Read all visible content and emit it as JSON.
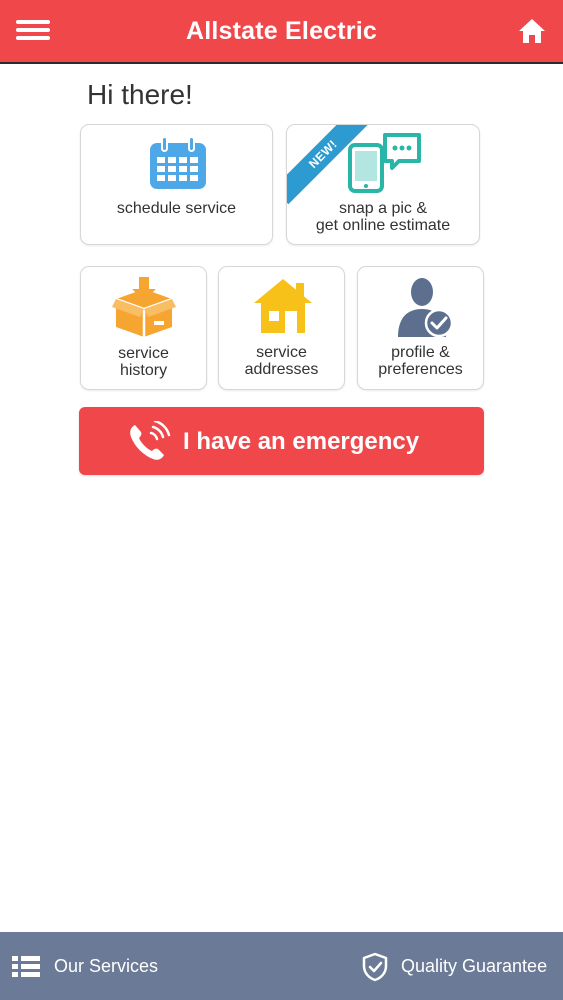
{
  "header": {
    "title": "Allstate Electric",
    "menu_icon": "hamburger-menu-icon",
    "home_icon": "home-icon"
  },
  "greeting": "Hi there!",
  "tiles": {
    "schedule": {
      "label": "schedule service",
      "icon": "calendar-icon"
    },
    "snap": {
      "badge": "NEW!",
      "label_line1": "snap a pic &",
      "label_line2": "get online estimate",
      "icon": "phone-chat-icon"
    },
    "history": {
      "label_line1": "service",
      "label_line2": "history",
      "icon": "box-download-icon"
    },
    "addresses": {
      "label_line1": "service",
      "label_line2": "addresses",
      "icon": "house-icon"
    },
    "profile": {
      "label_line1": "profile &",
      "label_line2": "preferences",
      "icon": "user-check-icon"
    }
  },
  "emergency": {
    "label": "I have an emergency",
    "icon": "phone-ringing-icon"
  },
  "bottom_nav": {
    "services": {
      "label": "Our Services",
      "icon": "list-icon"
    },
    "guarantee": {
      "label": "Quality Guarantee",
      "icon": "shield-check-icon"
    }
  },
  "colors": {
    "brand_red": "#f0474b",
    "bottom_bar": "#6b7a96",
    "badge_blue": "#2d9bd0",
    "icon_orange": "#f7a531",
    "icon_yellow": "#f7c11a",
    "icon_teal": "#29b6a8",
    "icon_blue": "#4ea8e8"
  }
}
